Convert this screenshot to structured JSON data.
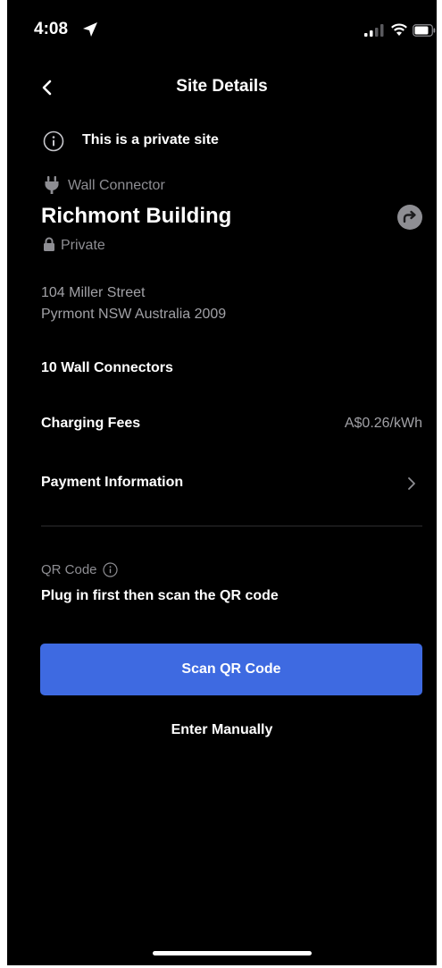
{
  "status_bar": {
    "time": "4:08"
  },
  "nav": {
    "title": "Site Details"
  },
  "notice": {
    "text": "This is a private site"
  },
  "site": {
    "type": "Wall Connector",
    "name": "Richmont Building",
    "access": "Private",
    "address_line1": "104 Miller Street",
    "address_line2": "Pyrmont NSW Australia 2009",
    "connectors": "10 Wall Connectors"
  },
  "fees": {
    "label": "Charging Fees",
    "value": "A$0.26/kWh"
  },
  "payment": {
    "label": "Payment Information"
  },
  "qr": {
    "label": "QR Code",
    "instruction": "Plug in first then scan the QR code",
    "scan_button": "Scan QR Code",
    "manual_button": "Enter Manually"
  },
  "colors": {
    "background": "#000000",
    "accent": "#3e6ae1",
    "secondary_text": "#8e8e93"
  },
  "icons": {
    "status": [
      "location-arrow-icon",
      "cellular-signal-icon",
      "wifi-icon",
      "battery-icon"
    ],
    "nav": [
      "back-chevron-icon"
    ],
    "content": [
      "info-circle-icon",
      "plug-icon",
      "navigate-arrow-icon",
      "lock-icon",
      "chevron-right-icon"
    ]
  }
}
